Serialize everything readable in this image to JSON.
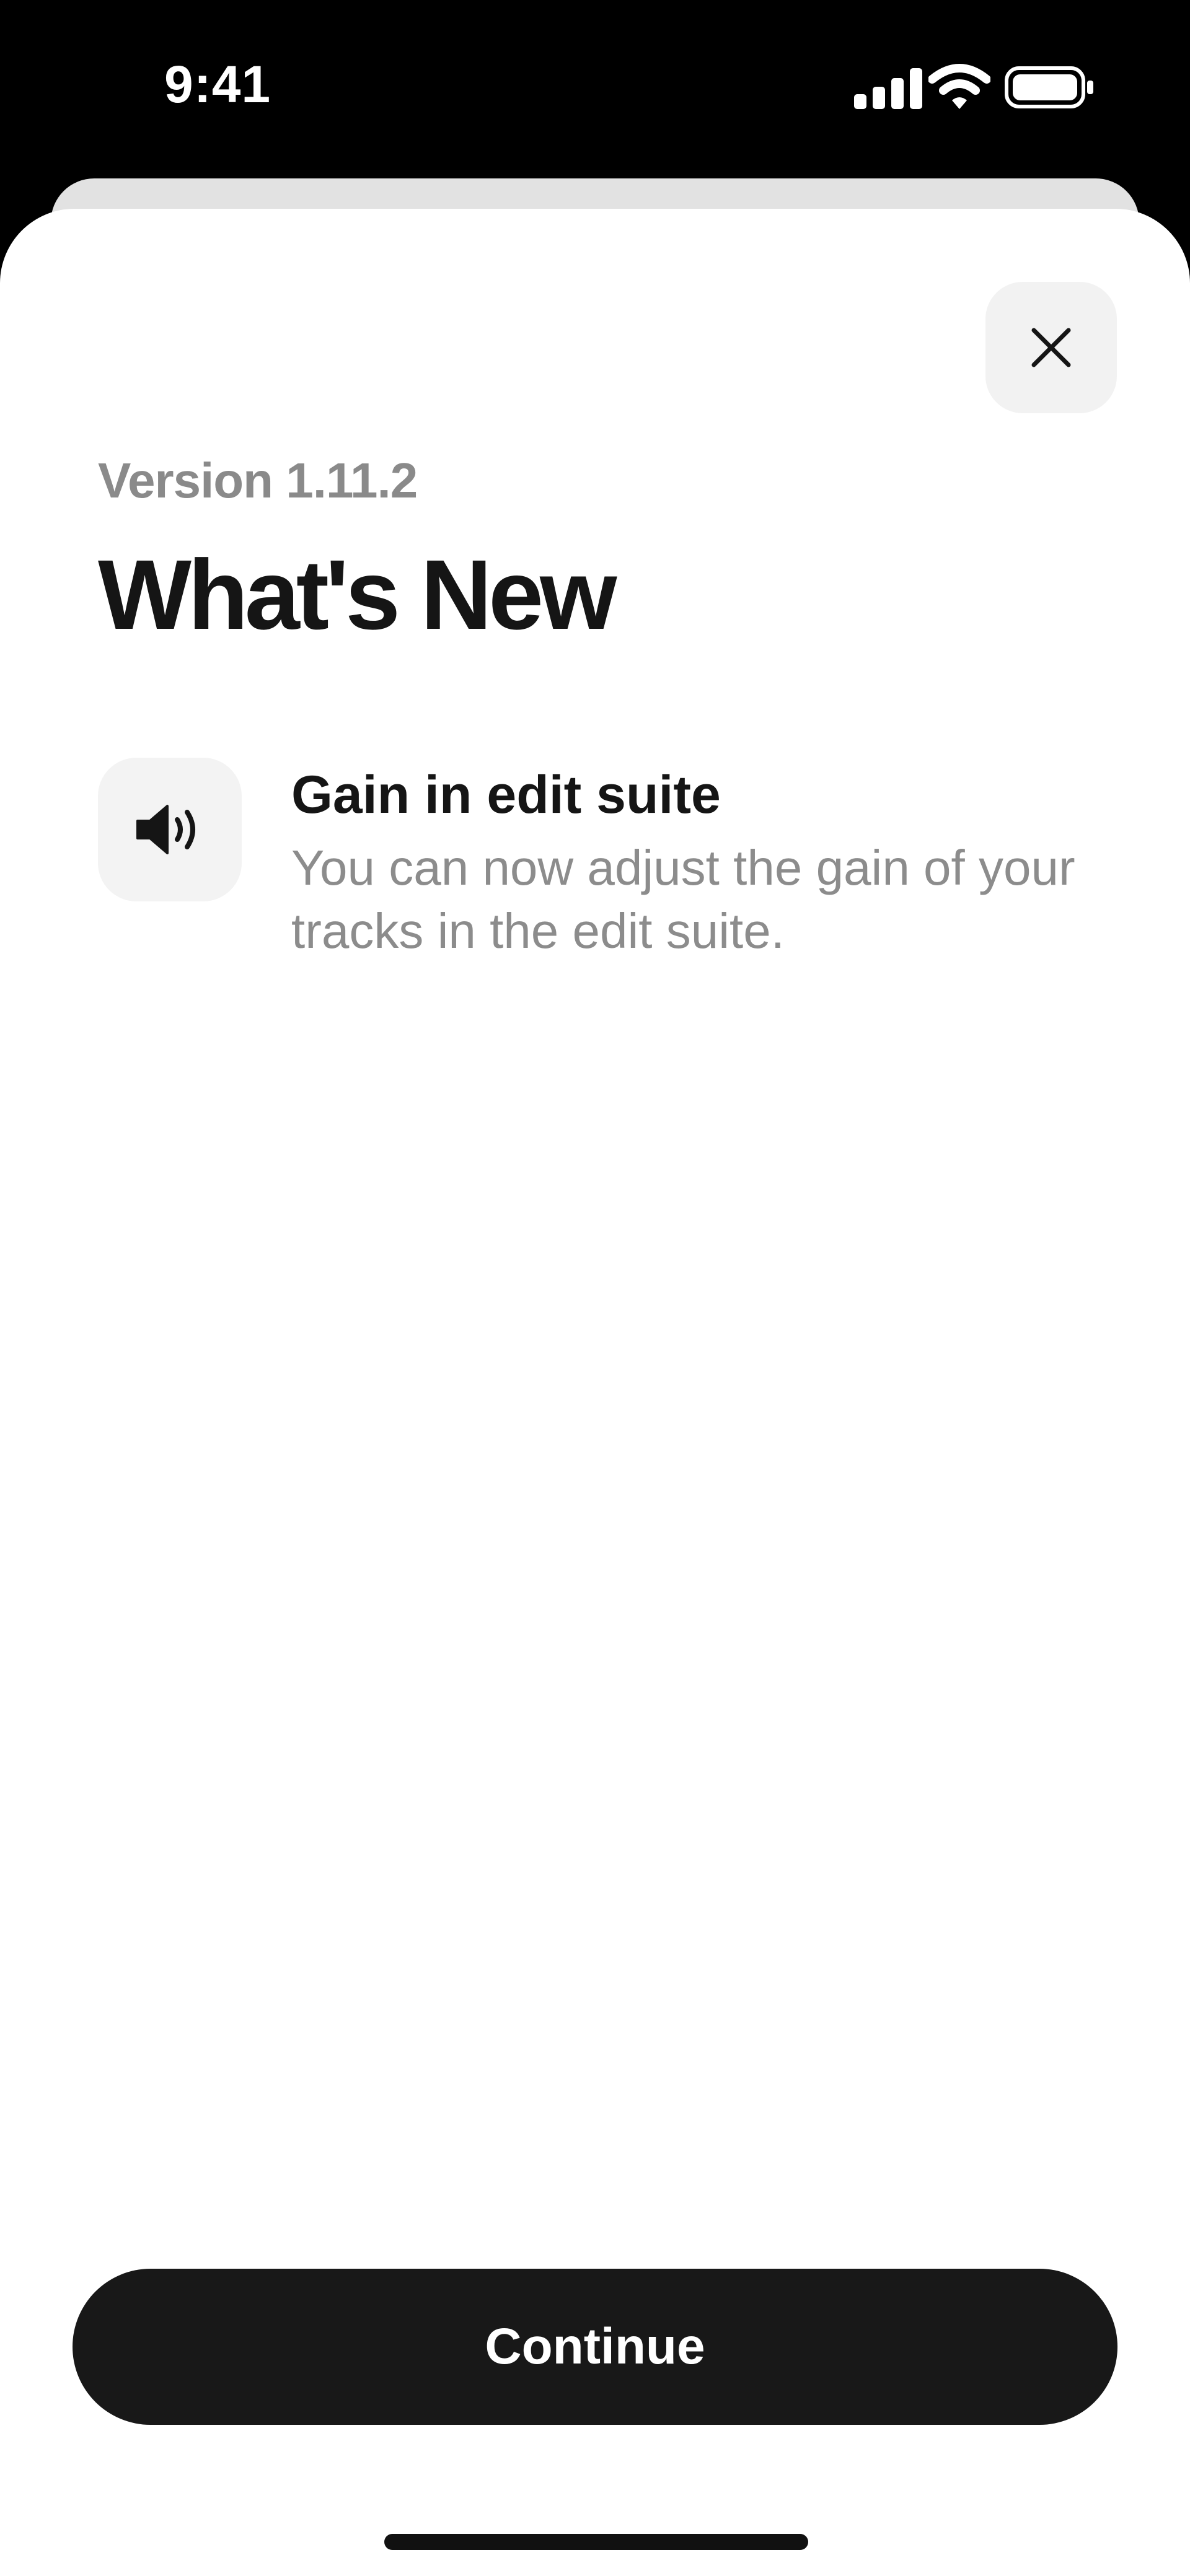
{
  "status_bar": {
    "time": "9:41",
    "icons": [
      "cellular-signal-icon",
      "wifi-icon",
      "battery-icon"
    ]
  },
  "sheet": {
    "close_icon": "close-icon",
    "version": "Version 1.11.2",
    "title": "What's New",
    "features": [
      {
        "icon": "speaker-volume-icon",
        "title": "Gain in edit suite",
        "description": "You can now adjust the gain of your tracks in the edit suite."
      }
    ],
    "continue_label": "Continue"
  },
  "colors": {
    "background": "#000000",
    "sheet": "#ffffff",
    "back_card": "#e2e2e2",
    "primary_text": "#151515",
    "secondary_text": "#8c8c8c",
    "icon_tile": "#f3f3f3",
    "button": "#181818",
    "button_text": "#ffffff"
  }
}
